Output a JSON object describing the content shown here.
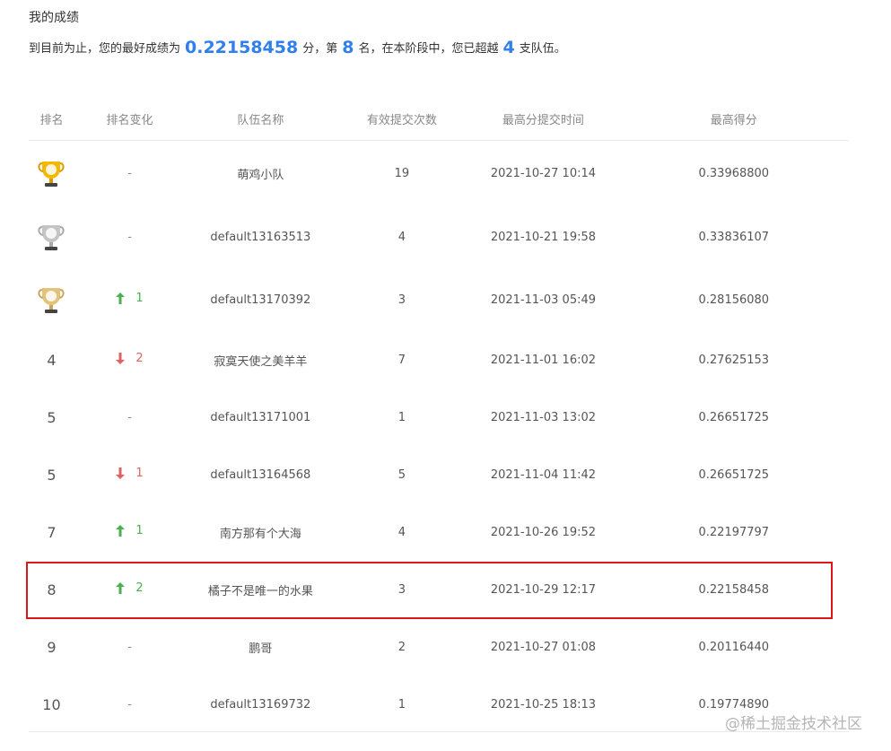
{
  "section_title": "我的成绩",
  "summary": {
    "prefix": "到目前为止，您的最好成绩为",
    "best_score": "0.22158458",
    "text_fen_rank": "分，第",
    "rank": "8",
    "text_stage": "名，在本阶段中，您已超越",
    "surpassed": "4",
    "text_suffix": "支队伍。"
  },
  "columns": [
    "排名",
    "排名变化",
    "队伍名称",
    "有效提交次数",
    "最高分提交时间",
    "最高得分"
  ],
  "rows": [
    {
      "rank": "1",
      "trophy": "gold",
      "change": "-",
      "change_dir": "none",
      "team": "萌鸡小队",
      "count": "19",
      "time": "2021-10-27 10:14",
      "score": "0.33968800"
    },
    {
      "rank": "2",
      "trophy": "silver",
      "change": "-",
      "change_dir": "none",
      "team": "default13163513",
      "count": "4",
      "time": "2021-10-21 19:58",
      "score": "0.33836107"
    },
    {
      "rank": "3",
      "trophy": "bronze",
      "change": "1",
      "change_dir": "up",
      "team": "default13170392",
      "count": "3",
      "time": "2021-11-03 05:49",
      "score": "0.28156080"
    },
    {
      "rank": "4",
      "trophy": "",
      "change": "2",
      "change_dir": "down",
      "team": "寂寞天使之美羊羊",
      "count": "7",
      "time": "2021-11-01 16:02",
      "score": "0.27625153"
    },
    {
      "rank": "5",
      "trophy": "",
      "change": "-",
      "change_dir": "none",
      "team": "default13171001",
      "count": "1",
      "time": "2021-11-03 13:02",
      "score": "0.26651725"
    },
    {
      "rank": "5",
      "trophy": "",
      "change": "1",
      "change_dir": "down",
      "team": "default13164568",
      "count": "5",
      "time": "2021-11-04 11:42",
      "score": "0.26651725"
    },
    {
      "rank": "7",
      "trophy": "",
      "change": "1",
      "change_dir": "up",
      "team": "南方那有个大海",
      "count": "4",
      "time": "2021-10-26 19:52",
      "score": "0.22197797"
    },
    {
      "rank": "8",
      "trophy": "",
      "change": "2",
      "change_dir": "up",
      "team": "橘子不是唯一的水果",
      "count": "3",
      "time": "2021-10-29 12:17",
      "score": "0.22158458"
    },
    {
      "rank": "9",
      "trophy": "",
      "change": "-",
      "change_dir": "none",
      "team": "鹏哥",
      "count": "2",
      "time": "2021-10-27 01:08",
      "score": "0.20116440"
    },
    {
      "rank": "10",
      "trophy": "",
      "change": "-",
      "change_dir": "none",
      "team": "default13169732",
      "count": "1",
      "time": "2021-10-25 18:13",
      "score": "0.19774890"
    }
  ],
  "watermark": "@稀土掘金技术社区",
  "colors": {
    "accent": "#2f80ed",
    "up": "#4caf50",
    "down": "#e06363",
    "highlight": "#d9171d",
    "gold": "#f5b800",
    "silver": "#c4c4c4",
    "bronze": "#e3c27a"
  },
  "icons": {
    "gold": "gold-trophy-icon",
    "silver": "silver-trophy-icon",
    "bronze": "bronze-trophy-icon",
    "up": "arrow-up-icon",
    "down": "arrow-down-icon"
  }
}
